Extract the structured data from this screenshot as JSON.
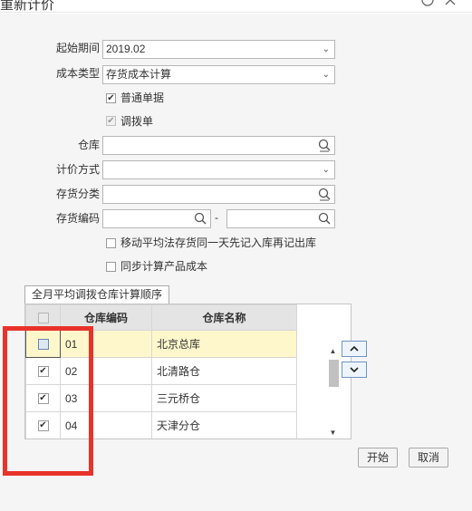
{
  "window": {
    "title": "重新计价",
    "help_icon": "help-icon",
    "close_icon": "close-icon"
  },
  "form": {
    "start_period": {
      "label": "起始期间",
      "value": "2019.02"
    },
    "cost_type": {
      "label": "成本类型",
      "value": "存货成本计算"
    },
    "normal_docs": {
      "label": "普通单据",
      "checked": true
    },
    "transfer_docs": {
      "label": "调拨单",
      "checked": true,
      "disabled": true
    },
    "warehouse": {
      "label": "仓库",
      "value": ""
    },
    "valuation_method": {
      "label": "计价方式",
      "value": ""
    },
    "inventory_class": {
      "label": "存货分类",
      "value": ""
    },
    "inventory_code": {
      "label": "存货编码",
      "from": "",
      "separator": "-",
      "to": ""
    },
    "moving_avg_option": {
      "label": "移动平均法存货同一天先记入库再记出库",
      "checked": false
    },
    "sync_product_cost": {
      "label": "同步计算产品成本",
      "checked": false
    }
  },
  "tab": {
    "label": "全月平均调拨仓库计算顺序"
  },
  "grid": {
    "columns": [
      "仓库编码",
      "仓库名称"
    ],
    "rows": [
      {
        "code": "01",
        "name": "北京总库",
        "checked": false,
        "selected": true
      },
      {
        "code": "02",
        "name": "北清路仓",
        "checked": true,
        "selected": false
      },
      {
        "code": "03",
        "name": "三元桥仓",
        "checked": true,
        "selected": false
      },
      {
        "code": "04",
        "name": "天津分仓",
        "checked": true,
        "selected": false
      }
    ]
  },
  "move_up_icon": "chevron-up-icon",
  "move_down_icon": "chevron-down-icon",
  "buttons": {
    "start": "开始",
    "cancel": "取消"
  },
  "colors": {
    "highlight": "#e8332b",
    "selected_row": "#fff7cc",
    "accent": "#6f94c4"
  }
}
